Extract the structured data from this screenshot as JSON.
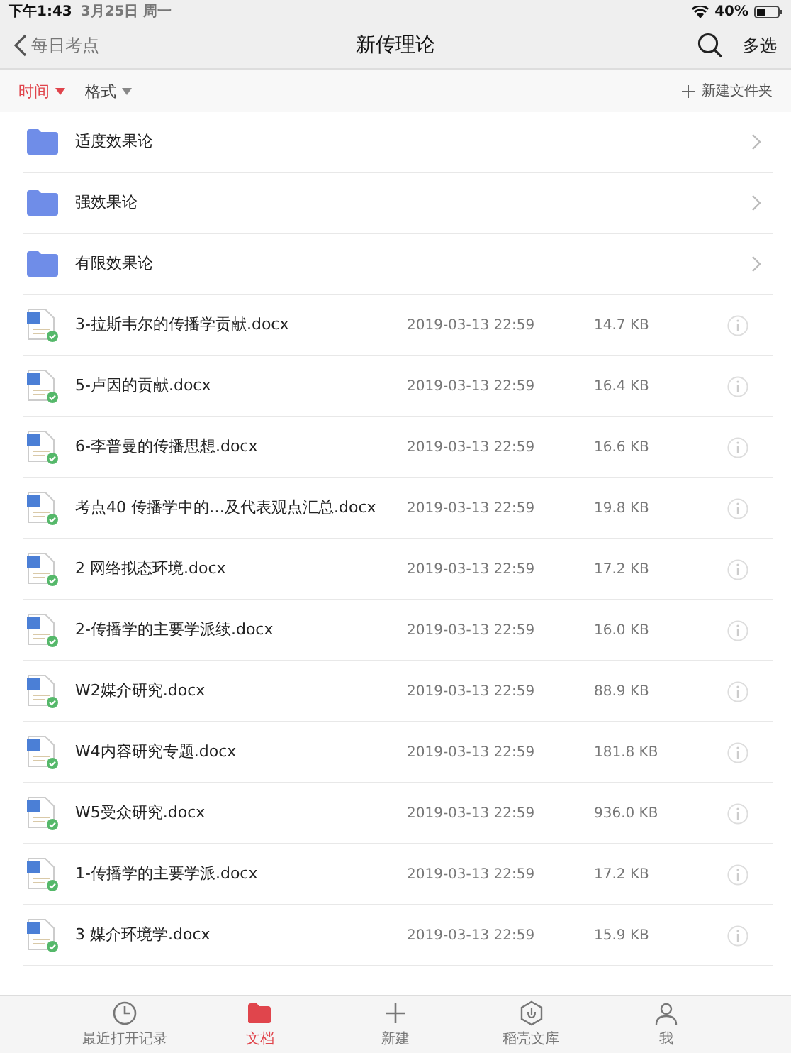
{
  "status_bar": {
    "time": "下午1:43",
    "date": "3月25日 周一",
    "battery": "40%"
  },
  "nav": {
    "back": "每日考点",
    "title": "新传理论",
    "action": "多选"
  },
  "sort": [
    {
      "label": "时间",
      "selected": true
    },
    {
      "label": "格式",
      "selected": false
    }
  ],
  "new_folder": "新建文件夹",
  "items": [
    {
      "kind": "folder",
      "name": "适度效果论"
    },
    {
      "kind": "folder",
      "name": "强效果论"
    },
    {
      "kind": "folder",
      "name": "有限效果论"
    },
    {
      "kind": "file",
      "name": "3-拉斯韦尔的传播学贡献.docx",
      "date": "2019-03-13 22:59",
      "size": "14.7 KB"
    },
    {
      "kind": "file",
      "name": "5-卢因的贡献.docx",
      "date": "2019-03-13 22:59",
      "size": "16.4 KB"
    },
    {
      "kind": "file",
      "name": "6-李普曼的传播思想.docx",
      "date": "2019-03-13 22:59",
      "size": "16.6 KB"
    },
    {
      "kind": "file",
      "name": "考点40 传播学中的…及代表观点汇总.docx",
      "date": "2019-03-13 22:59",
      "size": "19.8 KB"
    },
    {
      "kind": "file",
      "name": "2 网络拟态环境.docx",
      "date": "2019-03-13 22:59",
      "size": "17.2 KB"
    },
    {
      "kind": "file",
      "name": "2-传播学的主要学派续.docx",
      "date": "2019-03-13 22:59",
      "size": "16.0 KB"
    },
    {
      "kind": "file",
      "name": "W2媒介研究.docx",
      "date": "2019-03-13 22:59",
      "size": "88.9 KB"
    },
    {
      "kind": "file",
      "name": "W4内容研究专题.docx",
      "date": "2019-03-13 22:59",
      "size": "181.8 KB"
    },
    {
      "kind": "file",
      "name": "W5受众研究.docx",
      "date": "2019-03-13 22:59",
      "size": "936.0 KB"
    },
    {
      "kind": "file",
      "name": "1-传播学的主要学派.docx",
      "date": "2019-03-13 22:59",
      "size": "17.2 KB"
    },
    {
      "kind": "file",
      "name": "3 媒介环境学.docx",
      "date": "2019-03-13 22:59",
      "size": "15.9 KB"
    }
  ],
  "tabs": [
    {
      "kind": "recent",
      "label": "最近打开记录",
      "selected": false
    },
    {
      "kind": "docs",
      "label": "文档",
      "selected": true
    },
    {
      "kind": "new",
      "label": "新建",
      "selected": false
    },
    {
      "kind": "library",
      "label": "稻壳文库",
      "selected": false
    },
    {
      "kind": "me",
      "label": "我",
      "selected": false
    }
  ]
}
